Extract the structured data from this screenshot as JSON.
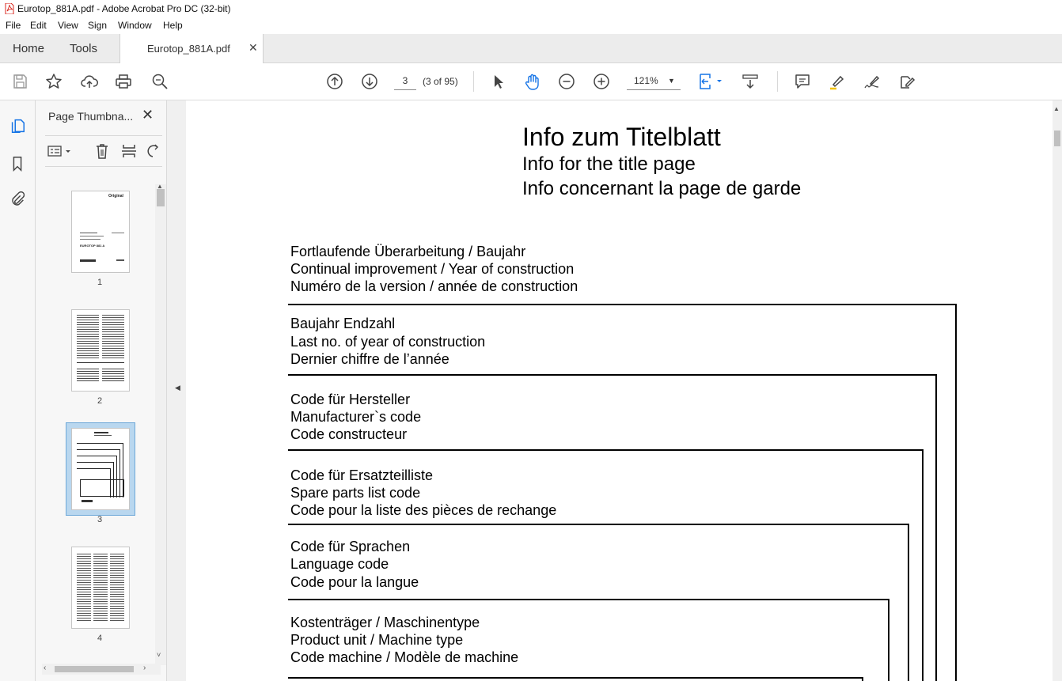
{
  "window": {
    "title": "Eurotop_881A.pdf - Adobe Acrobat Pro DC (32-bit)"
  },
  "menu": [
    "File",
    "Edit",
    "View",
    "Sign",
    "Window",
    "Help"
  ],
  "tabs": {
    "home": "Home",
    "tools": "Tools",
    "document": "Eurotop_881A.pdf"
  },
  "toolbar": {
    "page_number": "3",
    "page_count": "(3 of 95)",
    "zoom": "121%"
  },
  "thumbnails": {
    "title": "Page Thumbna...",
    "pages": [
      "1",
      "2",
      "3",
      "4"
    ],
    "selected_page": "3",
    "page1_text": {
      "brand": "Original",
      "model": "EUROTOP 881 A"
    }
  },
  "document": {
    "title_de": "Info  zum  Titelblatt",
    "title_en": "Info for the title page",
    "title_fr": "Info concernant la page de garde",
    "sections": [
      {
        "de": "Fortlaufende Überarbeitung / Baujahr",
        "en": "Continual improvement / Year of construction",
        "fr": "Numéro de la version / année de construction"
      },
      {
        "de": "Baujahr Endzahl",
        "en": "Last no. of year of construction",
        "fr": "Dernier chiffre de l’année"
      },
      {
        "de": "Code für Hersteller",
        "en": "Manufacturer`s  code",
        "fr": "Code constructeur"
      },
      {
        "de": "Code für Ersatzteilliste",
        "en": "Spare parts list code",
        "fr": "Code pour la liste des pièces de rechange"
      },
      {
        "de": "Code für Sprachen",
        "en": "Language code",
        "fr": "Code pour la langue"
      },
      {
        "de": "Kostenträger / Maschinentype",
        "en": "Product unit / Machine type",
        "fr": "Code machine / Modèle de machine"
      }
    ]
  },
  "colors": {
    "accent": "#1473e6",
    "selected_thumb_bg": "#b9d7ef",
    "pdf_icon": "#d9251c"
  }
}
